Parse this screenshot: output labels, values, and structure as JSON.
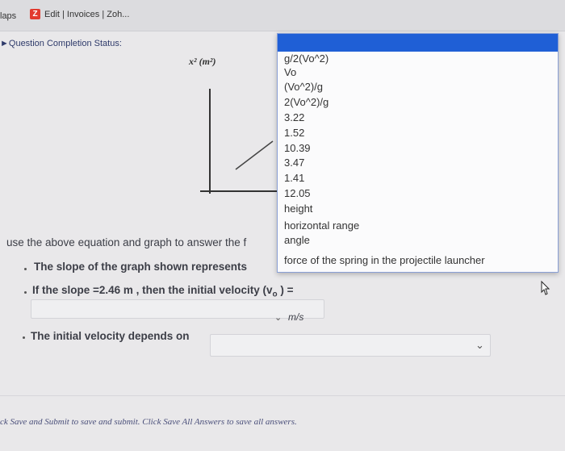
{
  "browser": {
    "bookmarks": [
      {
        "label": "laps"
      },
      {
        "label": "Edit | Invoices | Zoh..."
      }
    ]
  },
  "status": {
    "label": "Question Completion Status:"
  },
  "graph": {
    "ylabel": "x² (m²)"
  },
  "dropdown": {
    "options": [
      "g/2(Vo^2)",
      "Vo",
      "(Vo^2)/g",
      "2(Vo^2)/g",
      "3.22",
      "1.52",
      "10.39",
      "3.47",
      "1.41",
      "12.05",
      "height",
      "horizontal range",
      "angle",
      "force of the spring in the projectile launcher"
    ]
  },
  "question": {
    "intro": "use the above equation and graph to answer the f",
    "slope_text": "The slope of the graph shown represents",
    "velocity_text": "If the slope =2.46 m , then the initial velocity (v",
    "velocity_sub": "o",
    "velocity_tail": " ) =",
    "unit": "m/s",
    "depends_text": "The initial velocity depends on"
  },
  "footer": {
    "note": "ck Save and Submit to save and submit. Click Save All Answers to save all answers."
  },
  "colors": {
    "dropdown_header": "#1f5fd6",
    "page_bg": "#e9e8ea"
  }
}
